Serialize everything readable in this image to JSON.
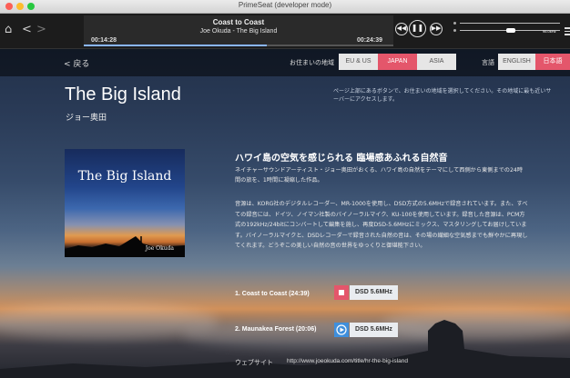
{
  "window": {
    "title": "PrimeSeat (developer mode)"
  },
  "player": {
    "track_title": "Coast to Coast",
    "artist_album": "Joe Okuda - The Big Island",
    "elapsed": "00:14:28",
    "duration": "00:24:39",
    "progress": 0.59,
    "volume": 0.46,
    "sample_rate": "96.0kHz"
  },
  "header": {
    "back_label": "< 戻る",
    "region_label": "お住まいの地域",
    "regions": [
      {
        "label": "EU & US",
        "active": false
      },
      {
        "label": "JAPAN",
        "active": true
      },
      {
        "label": "ASIA",
        "active": false
      }
    ],
    "language_label": "言語",
    "languages": [
      {
        "label": "ENGLISH",
        "active": false
      },
      {
        "label": "日本語",
        "active": true
      }
    ]
  },
  "album": {
    "title": "The Big Island",
    "artist": "ジョー奥田",
    "notice": "ページ上部にあるボタンで、お住まいの地域を選択してください。その地域に最も近いサーバーにアクセスします。",
    "cover": {
      "title": "The Big Island",
      "artist": "Joe Okuda"
    },
    "headline": "ハワイ島の空気を感じられる 臨場感あふれる自然音",
    "lead": "ネイチャーサウンドアーティスト・ジョー奥田がおくる、ハワイ島の自然をテーマにして西側から東側までの24時間の旅を、1時間に凝縮した作品。",
    "description": "音源は、KORG社のデジタルレコーダー、MR-1000を使用し、DSD方式の5.6MHzで録音されています。また、すべての録音には、ドイツ、ノイマン社製のバイノーラルマイク、KU-100を使用しています。録音した音源は、PCM方式の192kHz/24bitにコンバートして編集を施し、再度DSD-5.6MHzにミックス、マスタリングしてお届けしています。バイノーラルマイクと、DSDレコーダーで録音された自然の音は、その場の繊細な空気感までも鮮やかに再現してくれます。どうぞこの美しい自然の音の世界をゆっくりと御堪能下さい。"
  },
  "tracks": [
    {
      "title": "1. Coast to Coast (24:39)",
      "state": "playing",
      "format": "DSD 5.6MHz"
    },
    {
      "title": "2. Maunakea Forest (20:06)",
      "state": "stopped",
      "format": "DSD 5.6MHz"
    }
  ],
  "website": {
    "label": "ウェブサイト",
    "url": "http://www.joeokuda.com/title/hr-the-big-island"
  },
  "colors": {
    "accent": "#e4566b",
    "play_blue": "#3f8fdc"
  }
}
